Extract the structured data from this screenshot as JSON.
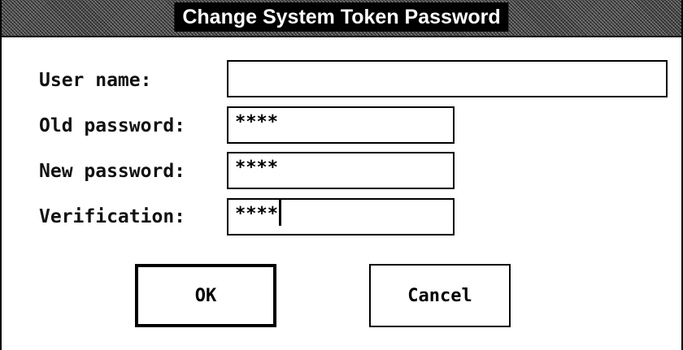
{
  "dialog": {
    "title": "Change System Token Password"
  },
  "form": {
    "user_name": {
      "label": "User name:",
      "value": ""
    },
    "old_password": {
      "label": "Old password:",
      "value": "****"
    },
    "new_password": {
      "label": "New password:",
      "value": "****"
    },
    "verification": {
      "label": "Verification:",
      "value": "****"
    }
  },
  "buttons": {
    "ok": "OK",
    "cancel": "Cancel"
  }
}
